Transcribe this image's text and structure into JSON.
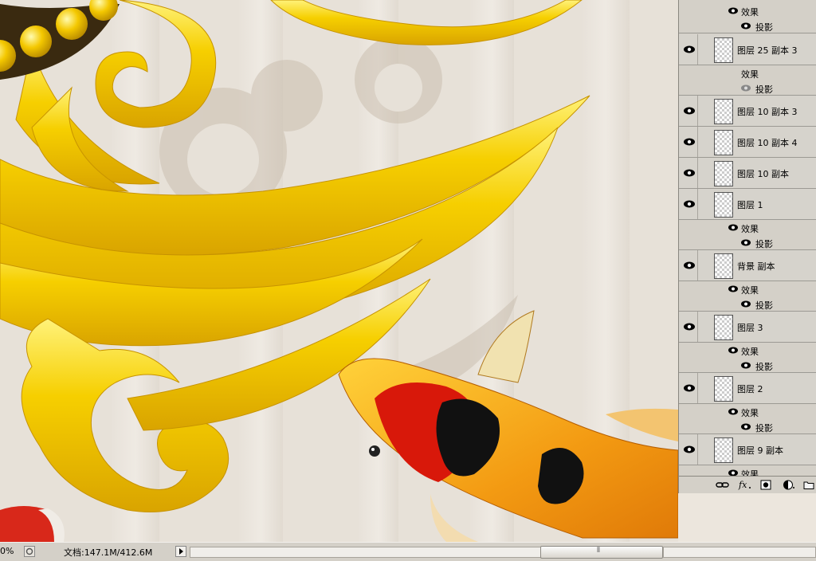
{
  "layers": [
    {
      "name": "图层 25 副本 3",
      "visible": true
    },
    {
      "name": "图层 10 副本 3",
      "visible": true
    },
    {
      "name": "图层 10 副本 4",
      "visible": true
    },
    {
      "name": "图层 10 副本",
      "visible": true
    },
    {
      "name": "图层 1",
      "visible": true
    },
    {
      "name": "背景 副本",
      "visible": true
    },
    {
      "name": "图层 3",
      "visible": true
    },
    {
      "name": "图层 2",
      "visible": true
    },
    {
      "name": "图层 9 副本",
      "visible": true
    }
  ],
  "effects_label": "效果",
  "shadow_label": "投影",
  "status": {
    "zoom": "0%",
    "doc_info": "文档:147.1M/412.6M"
  },
  "panel_icons": [
    "link-icon",
    "fx-icon",
    "mask-icon",
    "adjustment-icon",
    "folder-icon"
  ],
  "colors": {
    "gold": "#f2c200",
    "panel": "#d4d0c8",
    "fish_orange": "#f08a10",
    "fish_red": "#d81a0a"
  }
}
